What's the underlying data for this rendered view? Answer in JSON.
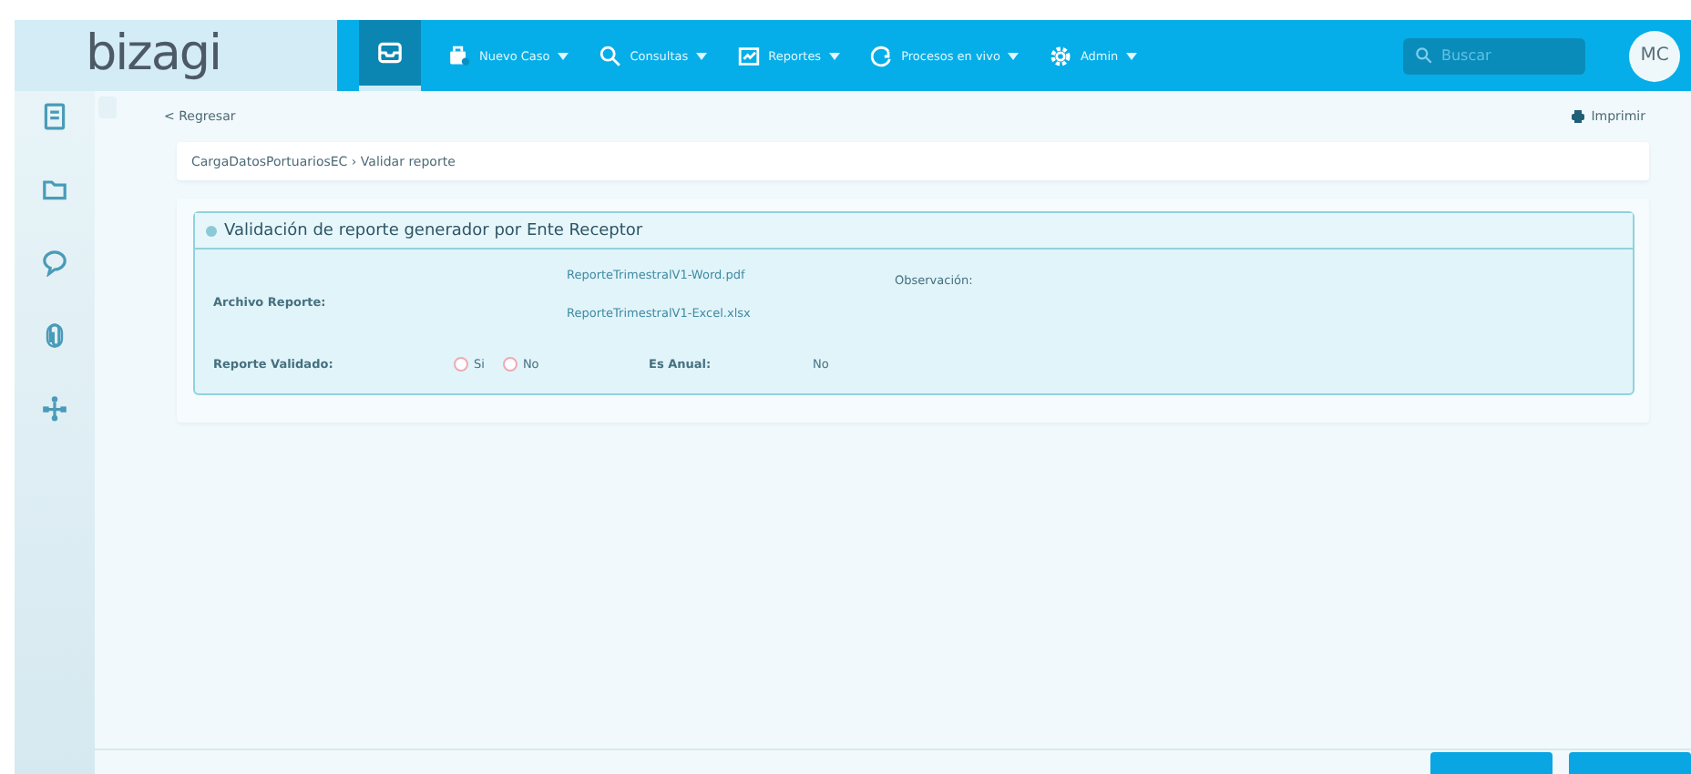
{
  "header": {
    "logo": "bizagi",
    "nav": [
      {
        "kind": "home",
        "selected": true
      },
      {
        "kind": "case",
        "label": "Nuevo Caso",
        "selected": false
      },
      {
        "kind": "search",
        "label": "Consultas",
        "selected": false
      },
      {
        "kind": "report",
        "label": "Reportes",
        "selected": false
      },
      {
        "kind": "live",
        "label": "Procesos en vivo",
        "selected": false
      },
      {
        "kind": "admin",
        "label": "Admin",
        "selected": false
      }
    ],
    "search": {
      "placeholder": "Buscar"
    },
    "avatar": "MC"
  },
  "sidebar": {
    "items": [
      {
        "kind": "inbox"
      },
      {
        "kind": "folder"
      },
      {
        "kind": "chat"
      },
      {
        "kind": "clip"
      },
      {
        "kind": "flow"
      }
    ]
  },
  "toolbar": {
    "back": "< Regresar",
    "print": "Imprimir"
  },
  "breadcrumb": "CargaDatosPortuariosEC › Validar reporte",
  "panel": {
    "title": "Validación de reporte generador por Ente Receptor",
    "expanded": true,
    "archivo_label": "Archivo Reporte:",
    "files": [
      "ReporteTrimestralV1-Word.pdf",
      "ReporteTrimestralV1-Excel.xlsx"
    ],
    "observacion_label": "Observación:",
    "validado_label": "Reporte Validado:",
    "options": [
      {
        "label": "Si",
        "selected": false
      },
      {
        "label": "No",
        "selected": false
      }
    ],
    "anual_label": "Es Anual:",
    "anual_value": "No"
  },
  "footer": {
    "buttons": [
      {
        "kind": "primary"
      },
      {
        "kind": "primary"
      }
    ]
  }
}
